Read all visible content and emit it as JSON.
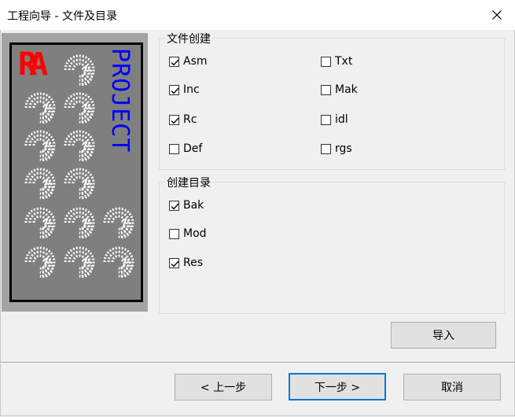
{
  "window": {
    "title": "工程向导 - 文件及目录"
  },
  "art": {
    "logo_text": "RA",
    "vertical_text": "PROJECT",
    "colors": {
      "logo": "#ff0000",
      "text": "#0000ff"
    }
  },
  "file_group": {
    "legend": "文件创建",
    "items": [
      {
        "label": "Asm",
        "checked": true
      },
      {
        "label": "Txt",
        "checked": false
      },
      {
        "label": "Inc",
        "checked": true
      },
      {
        "label": "Mak",
        "checked": false
      },
      {
        "label": "Rc",
        "checked": true
      },
      {
        "label": "idl",
        "checked": false
      },
      {
        "label": "Def",
        "checked": false
      },
      {
        "label": "rgs",
        "checked": false
      }
    ]
  },
  "dir_group": {
    "legend": "创建目录",
    "items": [
      {
        "label": "Bak",
        "checked": true
      },
      {
        "label": "Mod",
        "checked": false
      },
      {
        "label": "Res",
        "checked": true
      }
    ]
  },
  "buttons": {
    "import": "导入",
    "prev": "< 上一步",
    "next": "下一步 >",
    "cancel": "取消"
  }
}
